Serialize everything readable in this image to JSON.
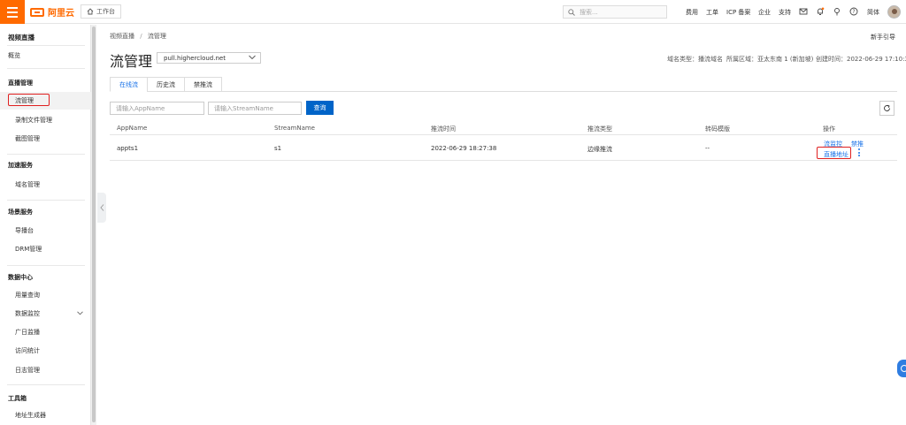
{
  "topbar": {
    "logo_text": "阿里云",
    "workbench_label": "工作台",
    "search_placeholder": "搜索...",
    "nav": [
      "费用",
      "工单",
      "ICP 备案",
      "企业",
      "支持"
    ],
    "lang": "简体"
  },
  "sidebar": {
    "title": "视频直播",
    "overview": "概览",
    "groups": [
      {
        "label": "直播管理",
        "items": [
          "流管理",
          "录制文件管理",
          "截图管理"
        ]
      },
      {
        "label": "加速服务",
        "items": [
          "域名管理"
        ]
      },
      {
        "label": "场景服务",
        "items": [
          "导播台",
          "DRM管理"
        ]
      },
      {
        "label": "数据中心",
        "items": [
          "用量查询",
          "数据监控",
          "广日监播",
          "访问统计",
          "日志管理"
        ]
      },
      {
        "label": "工具箱",
        "items": [
          "地址生成器"
        ]
      }
    ]
  },
  "breadcrumb": {
    "root": "视频直播",
    "sep": "/",
    "current": "流管理"
  },
  "guide_link": "新手引导",
  "page_title": "流管理",
  "domain_select": "pull.highercloud.net",
  "meta": {
    "domain_type": "域名类型：播流域名",
    "region": "所属区域：亚太东南 1 (新加坡)",
    "created": "创建时间：2022-06-29 17:10:39"
  },
  "tabs": [
    "在线流",
    "历史流",
    "禁推流"
  ],
  "filters": {
    "appname_placeholder": "请输入AppName",
    "streamname_placeholder": "请输入StreamName",
    "query_label": "查询"
  },
  "table": {
    "headers": [
      "AppName",
      "StreamName",
      "推流时间",
      "推流类型",
      "转码模版",
      "操作"
    ],
    "rows": [
      {
        "app": "appts1",
        "stream": "s1",
        "time": "2022-06-29 18:27:38",
        "type": "边缘推流",
        "template": "--"
      }
    ],
    "ops": {
      "monitor": "流监控",
      "disable": "禁推",
      "live_url": "直播地址"
    }
  },
  "colors": {
    "brand": "#ff6a00",
    "primary": "#0064c8",
    "link": "#1a73e8",
    "highlight": "#e02020"
  }
}
